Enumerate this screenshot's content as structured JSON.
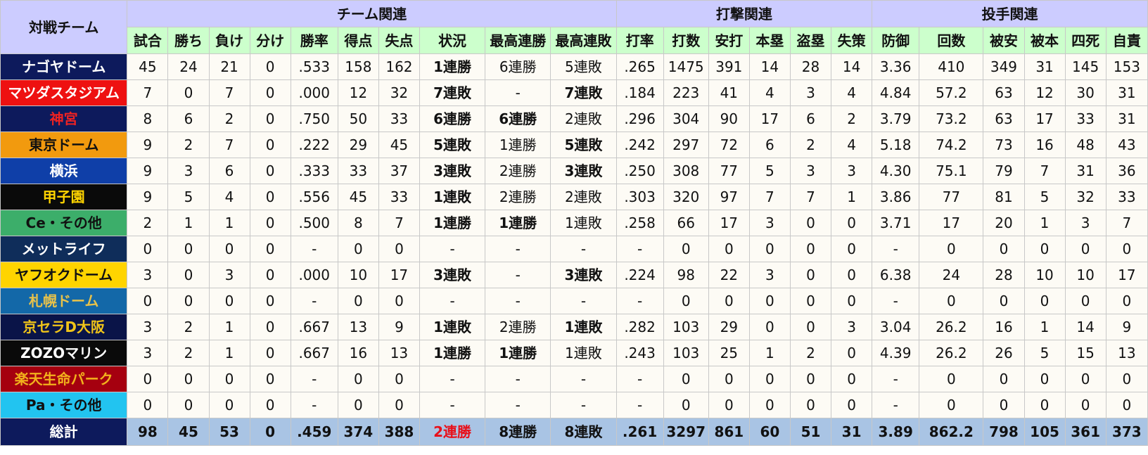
{
  "header": {
    "corner": "対戦チーム",
    "groups": [
      "チーム関連",
      "打撃関連",
      "投手関連"
    ],
    "columns": [
      "試合",
      "勝ち",
      "負け",
      "分け",
      "勝率",
      "得点",
      "失点",
      "状況",
      "最高連勝",
      "最高連敗",
      "打率",
      "打数",
      "安打",
      "本塁",
      "盗塁",
      "失策",
      "防御",
      "回数",
      "被安",
      "被本",
      "四死",
      "自責"
    ]
  },
  "style_classes": [
    "plain",
    "win",
    "lose"
  ],
  "rows": [
    {
      "team": "ナゴヤドーム",
      "bg": "#0d1a5c",
      "fg": "#ffffff",
      "cells": [
        "45",
        "24",
        "21",
        "0",
        ".533",
        "158",
        "162",
        "1連勝",
        "6連勝",
        "5連敗",
        ".265",
        "1475",
        "391",
        "14",
        "28",
        "14",
        "3.36",
        "410",
        "349",
        "31",
        "145",
        "153"
      ],
      "cls": {
        "7": 1
      }
    },
    {
      "team": "マツダスタジアム",
      "bg": "#ee1111",
      "fg": "#ffffff",
      "cells": [
        "7",
        "0",
        "7",
        "0",
        ".000",
        "12",
        "32",
        "7連敗",
        "-",
        "7連敗",
        ".184",
        "223",
        "41",
        "4",
        "3",
        "4",
        "4.84",
        "57.2",
        "63",
        "12",
        "30",
        "31"
      ],
      "cls": {
        "7": 2,
        "9": 2
      }
    },
    {
      "team": "神宮",
      "bg": "#0d1a5c",
      "fg": "#ee2222",
      "cells": [
        "8",
        "6",
        "2",
        "0",
        ".750",
        "50",
        "33",
        "6連勝",
        "6連勝",
        "2連敗",
        ".296",
        "304",
        "90",
        "17",
        "6",
        "2",
        "3.79",
        "73.2",
        "63",
        "17",
        "33",
        "31"
      ],
      "cls": {
        "7": 1,
        "8": 1
      }
    },
    {
      "team": "東京ドーム",
      "bg": "#f29a0e",
      "fg": "#111111",
      "cells": [
        "9",
        "2",
        "7",
        "0",
        ".222",
        "29",
        "45",
        "5連敗",
        "1連勝",
        "5連敗",
        ".242",
        "297",
        "72",
        "6",
        "2",
        "4",
        "5.18",
        "74.2",
        "73",
        "16",
        "48",
        "43"
      ],
      "cls": {
        "7": 2,
        "9": 2
      }
    },
    {
      "team": "横浜",
      "bg": "#0f3fa8",
      "fg": "#ffffff",
      "cells": [
        "9",
        "3",
        "6",
        "0",
        ".333",
        "33",
        "37",
        "3連敗",
        "2連勝",
        "3連敗",
        ".250",
        "308",
        "77",
        "5",
        "3",
        "3",
        "4.30",
        "75.1",
        "79",
        "7",
        "31",
        "36"
      ],
      "cls": {
        "7": 2,
        "9": 2
      }
    },
    {
      "team": "甲子園",
      "bg": "#0a0a0a",
      "fg": "#ffd400",
      "cells": [
        "9",
        "5",
        "4",
        "0",
        ".556",
        "45",
        "33",
        "1連敗",
        "2連勝",
        "2連敗",
        ".303",
        "320",
        "97",
        "7",
        "7",
        "1",
        "3.86",
        "77",
        "81",
        "5",
        "32",
        "33"
      ],
      "cls": {
        "7": 2
      }
    },
    {
      "team": "Ce・その他",
      "bg": "#3cae6a",
      "fg": "#111111",
      "cells": [
        "2",
        "1",
        "1",
        "0",
        ".500",
        "8",
        "7",
        "1連勝",
        "1連勝",
        "1連敗",
        ".258",
        "66",
        "17",
        "3",
        "0",
        "0",
        "3.71",
        "17",
        "20",
        "1",
        "3",
        "7"
      ],
      "cls": {
        "7": 1,
        "8": 1
      }
    },
    {
      "team": "メットライフ",
      "bg": "#0f2d5a",
      "fg": "#ffffff",
      "cells": [
        "0",
        "0",
        "0",
        "0",
        "-",
        "0",
        "0",
        "-",
        "-",
        "-",
        "-",
        "0",
        "0",
        "0",
        "0",
        "0",
        "-",
        "0",
        "0",
        "0",
        "0",
        "0"
      ],
      "cls": {}
    },
    {
      "team": "ヤフオクドーム",
      "bg": "#ffd400",
      "fg": "#111111",
      "cells": [
        "3",
        "0",
        "3",
        "0",
        ".000",
        "10",
        "17",
        "3連敗",
        "-",
        "3連敗",
        ".224",
        "98",
        "22",
        "3",
        "0",
        "0",
        "6.38",
        "24",
        "28",
        "10",
        "10",
        "17"
      ],
      "cls": {
        "7": 2,
        "9": 2
      }
    },
    {
      "team": "札幌ドーム",
      "bg": "#1368a8",
      "fg": "#e8c24a",
      "cells": [
        "0",
        "0",
        "0",
        "0",
        "-",
        "0",
        "0",
        "-",
        "-",
        "-",
        "-",
        "0",
        "0",
        "0",
        "0",
        "0",
        "-",
        "0",
        "0",
        "0",
        "0",
        "0"
      ],
      "cls": {}
    },
    {
      "team": "京セラD大阪",
      "bg": "#0a1448",
      "fg": "#f0c419",
      "cells": [
        "3",
        "2",
        "1",
        "0",
        ".667",
        "13",
        "9",
        "1連敗",
        "2連勝",
        "1連敗",
        ".282",
        "103",
        "29",
        "0",
        "0",
        "3",
        "3.04",
        "26.2",
        "16",
        "1",
        "14",
        "9"
      ],
      "cls": {
        "7": 2,
        "9": 2
      }
    },
    {
      "team": "ZOZOマリン",
      "bg": "#0a0a0a",
      "fg": "#ffffff",
      "cells": [
        "3",
        "2",
        "1",
        "0",
        ".667",
        "16",
        "13",
        "1連勝",
        "1連勝",
        "1連敗",
        ".243",
        "103",
        "25",
        "1",
        "2",
        "0",
        "4.39",
        "26.2",
        "26",
        "5",
        "15",
        "13"
      ],
      "cls": {
        "7": 1,
        "8": 1
      }
    },
    {
      "team": "楽天生命パーク",
      "bg": "#a5000f",
      "fg": "#f2b21c",
      "cells": [
        "0",
        "0",
        "0",
        "0",
        "-",
        "0",
        "0",
        "-",
        "-",
        "-",
        "-",
        "0",
        "0",
        "0",
        "0",
        "0",
        "-",
        "0",
        "0",
        "0",
        "0",
        "0"
      ],
      "cls": {}
    },
    {
      "team": "Pa・その他",
      "bg": "#22c4f0",
      "fg": "#111111",
      "cells": [
        "0",
        "0",
        "0",
        "0",
        "-",
        "0",
        "0",
        "-",
        "-",
        "-",
        "-",
        "0",
        "0",
        "0",
        "0",
        "0",
        "-",
        "0",
        "0",
        "0",
        "0",
        "0"
      ],
      "cls": {}
    }
  ],
  "total": {
    "team": "総計",
    "cells": [
      "98",
      "45",
      "53",
      "0",
      ".459",
      "374",
      "388",
      "2連勝",
      "8連勝",
      "8連敗",
      ".261",
      "3297",
      "861",
      "60",
      "51",
      "31",
      "3.89",
      "862.2",
      "798",
      "105",
      "361",
      "373"
    ],
    "cls": {
      "7": 1
    }
  }
}
